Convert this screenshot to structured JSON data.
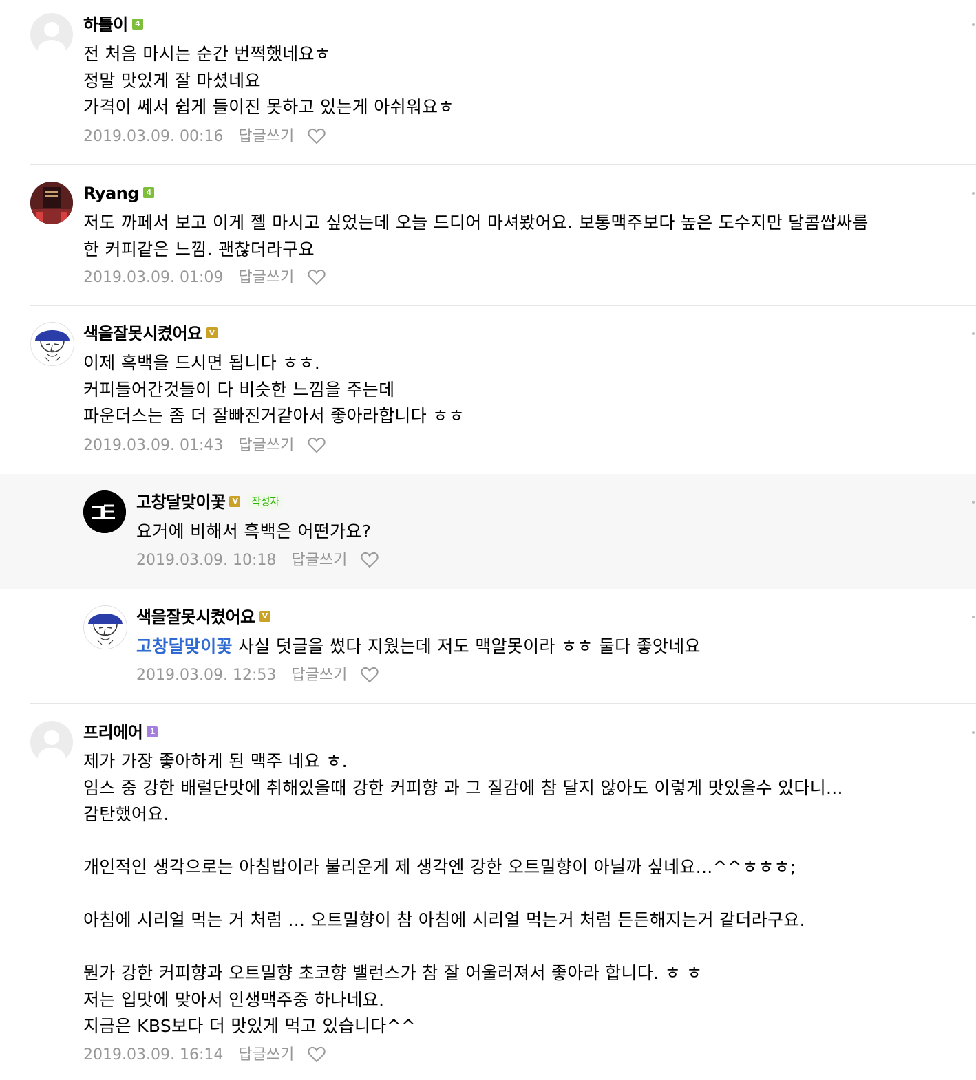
{
  "comments": [
    {
      "nickname": "하틀이",
      "level": "4",
      "body": "전 처음 마시는 순간 번쩍했네요ㅎ\n정말 맛있게 잘 마셨네요\n가격이 쎄서 쉽게 들이진 못하고 있는게 아쉬워요ㅎ",
      "date": "2019.03.09. 00:16",
      "reply_label": "답글쓰기"
    },
    {
      "nickname": "Ryang",
      "level": "4",
      "body": "저도 까페서 보고 이게 젤 마시고 싶었는데 오늘 드디어 마셔봤어요. 보통맥주보다 높은 도수지만 달콤쌉싸름\n한 커피같은 느낌. 괜찮더라구요",
      "date": "2019.03.09. 01:09",
      "reply_label": "답글쓰기"
    },
    {
      "nickname": "색을잘못시켰어요",
      "level": "V",
      "body": "이제 흑백을 드시면 됩니다 ㅎㅎ.\n커피들어간것들이 다 비슷한 느낌을 주는데\n파운더스는 좀 더 잘빠진거같아서 좋아라합니다 ㅎㅎ",
      "date": "2019.03.09. 01:43",
      "reply_label": "답글쓰기"
    },
    {
      "nickname": "고창달맞이꽃",
      "level": "V",
      "author_badge": "작성자",
      "avatar_text": "ᄀᄃ",
      "body": "요거에 비해서 흑백은 어떤가요?",
      "date": "2019.03.09. 10:18",
      "reply_label": "답글쓰기"
    },
    {
      "nickname": "색을잘못시켰어요",
      "level": "V",
      "mention": "고창달맞이꽃",
      "body": " 사실 덧글을 썼다 지웠는데 저도 맥알못이라 ㅎㅎ 둘다 좋앗네요",
      "date": "2019.03.09. 12:53",
      "reply_label": "답글쓰기"
    },
    {
      "nickname": "프리에어",
      "level": "1",
      "body": "제가 가장 좋아하게 된 맥주 네요 ㅎ.\n임스 중 강한 배럴단맛에 취해있을때 강한 커피향 과 그 질감에 참 달지 않아도 이렇게 맛있을수 있다니...\n감탄했어요.\n\n개인적인 생각으로는 아침밥이라 불리운게 제 생각엔 강한 오트밀향이 아닐까 싶네요...^^ㅎㅎㅎ;\n\n아침에 시리얼 먹는 거 처럼 ... 오트밀향이 참 아침에 시리얼 먹는거 처럼 든든해지는거 같더라구요.\n\n뭔가 강한 커피향과 오트밀향 초코향 밸런스가 참 잘 어울러져서 좋아라 합니다. ㅎ ㅎ\n저는 입맛에 맞아서 인생맥주중 하나네요.\n지금은 KBS보다 더 맛있게 먹고 있습니다^^",
      "date": "2019.03.09. 16:14",
      "reply_label": "답글쓰기"
    }
  ],
  "colors": {
    "level_green": "#7dbf3a",
    "level_gold": "#c9a227",
    "level_purple": "#a57fe0",
    "mention": "#2e6ad1",
    "meta_gray": "#979797",
    "reply_bg": "#f7f7f7"
  },
  "icons": {
    "like": "heart-outline-icon",
    "more": "more-dots-icon",
    "default_avatar": "default-profile-icon"
  }
}
